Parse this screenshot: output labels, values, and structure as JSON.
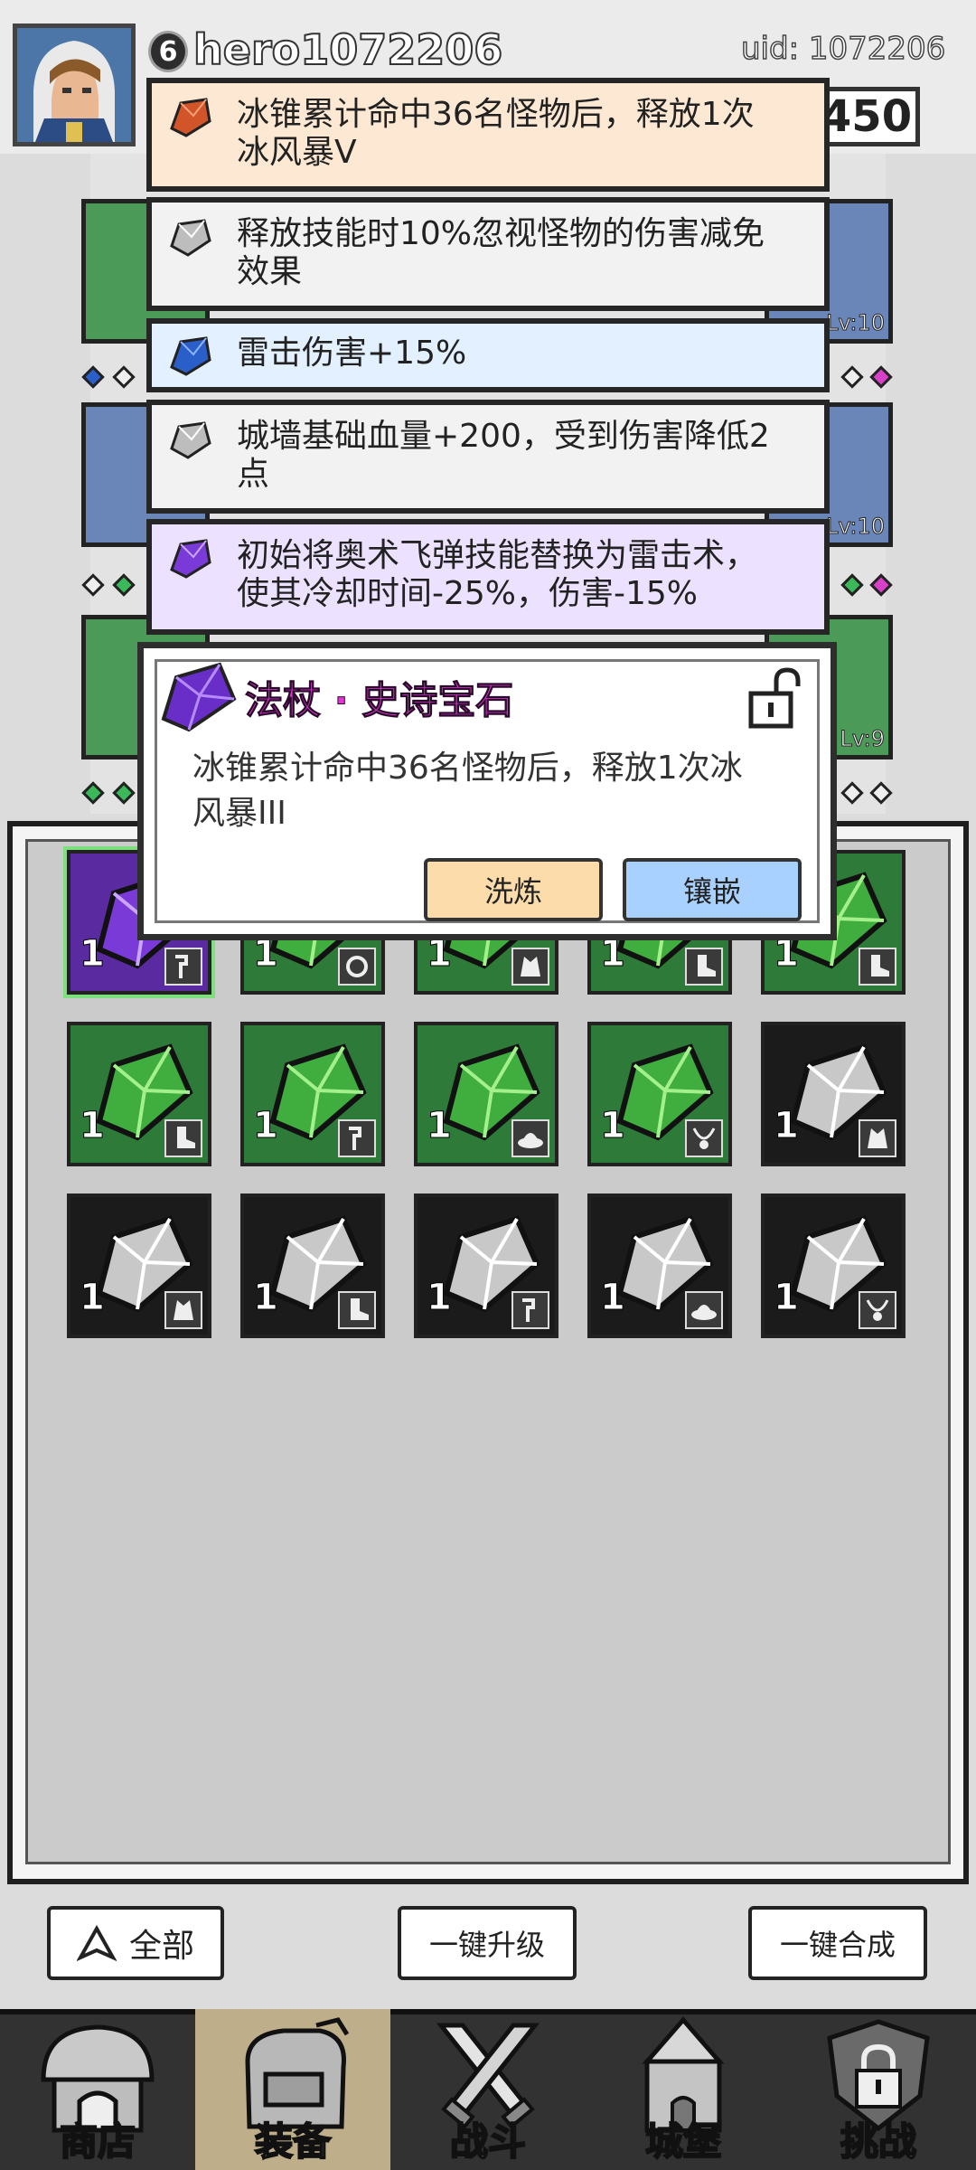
{
  "player": {
    "level": "6",
    "name": "hero1072206",
    "uid": "uid: 1072206",
    "power_partial": "450"
  },
  "affixes": [
    {
      "gem": "orange-gem",
      "text_line1": "冰锥累计命中36名怪物后，释放1次",
      "text_line2": "冰风暴V",
      "bg": "#fde9d3"
    },
    {
      "gem": "white-gem",
      "text_line1": "释放技能时10%忽视怪物的伤害减免",
      "text_line2": "效果",
      "bg": "#f2f2f2"
    },
    {
      "gem": "blue-gem",
      "text_line1": "雷击伤害+15%",
      "text_line2": "",
      "bg": "#e3f0ff"
    },
    {
      "gem": "white-gem",
      "text_line1": "城墙基础血量+200，受到伤害降低2",
      "text_line2": "点",
      "bg": "#f2f2f2"
    },
    {
      "gem": "purple-gem",
      "text_line1": "初始将奥术飞弹技能替换为雷击术，",
      "text_line2": "使其冷却时间-25%，伤害-15%",
      "bg": "#ece1ff"
    }
  ],
  "equipment": {
    "slot_levels": [
      "Lv:10",
      "Lv:10",
      "Lv:9"
    ]
  },
  "popup": {
    "title": "法杖 · 史诗宝石",
    "desc_line1": "冰锥累计命中36名怪物后，释放1次冰",
    "desc_line2": "风暴III",
    "btn_refine": "洗炼",
    "btn_inlay": "镶嵌"
  },
  "inventory": {
    "rows": [
      [
        {
          "gem": "purple",
          "count": "1",
          "tag": "staff-icon"
        },
        {
          "gem": "green",
          "count": "1",
          "tag": "ring-icon"
        },
        {
          "gem": "green",
          "count": "1",
          "tag": "armor-icon"
        },
        {
          "gem": "green",
          "count": "1",
          "tag": "boot-icon"
        },
        {
          "gem": "green",
          "count": "1",
          "tag": "boot-icon"
        }
      ],
      [
        {
          "gem": "green",
          "count": "1",
          "tag": "boot-icon"
        },
        {
          "gem": "green",
          "count": "1",
          "tag": "staff-icon"
        },
        {
          "gem": "green",
          "count": "1",
          "tag": "hat-icon"
        },
        {
          "gem": "green",
          "count": "1",
          "tag": "necklace-icon"
        },
        {
          "gem": "white",
          "count": "1",
          "tag": "armor-icon"
        }
      ],
      [
        {
          "gem": "white",
          "count": "1",
          "tag": "armor-icon"
        },
        {
          "gem": "white",
          "count": "1",
          "tag": "boot-icon"
        },
        {
          "gem": "white",
          "count": "1",
          "tag": "staff-icon"
        },
        {
          "gem": "white",
          "count": "1",
          "tag": "hat-icon"
        },
        {
          "gem": "white",
          "count": "1",
          "tag": "necklace-icon"
        }
      ]
    ]
  },
  "actions": {
    "filter_all": "全部",
    "upgrade_all": "一键升级",
    "merge_all": "一键合成"
  },
  "nav": {
    "shop": "商店",
    "equipment": "装备",
    "battle": "战斗",
    "castle": "城堡",
    "challenge": "挑战"
  },
  "colors": {
    "popup_title": "#e236d6",
    "refine_button": "#fbdcaa",
    "inlay_button": "#a9d1ff",
    "nav_selected": "#bfae8a"
  }
}
